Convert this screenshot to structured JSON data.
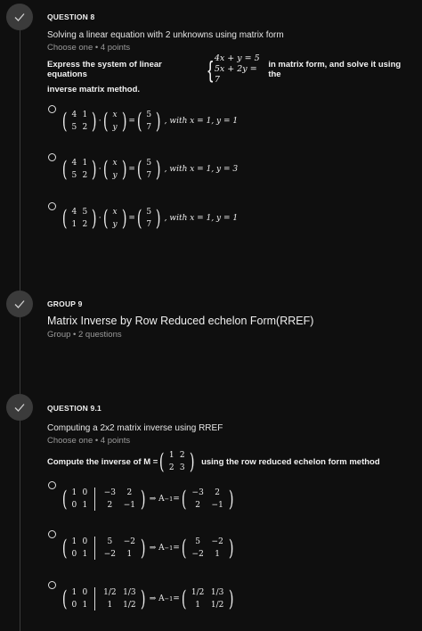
{
  "q8": {
    "label": "QUESTION 8",
    "title": "Solving a linear equation with 2 unknowns using matrix form",
    "meta": "Choose one • 4 points",
    "prompt_pre": "Express the system of linear equations",
    "eq1": "4x + y = 5",
    "eq2": "5x + 2y = 7",
    "prompt_post": "in matrix form, and solve it using the",
    "prompt_line2": "inverse matrix method.",
    "options": [
      {
        "m": [
          "4",
          "1",
          "5",
          "2"
        ],
        "v": [
          "x",
          "y"
        ],
        "r": [
          "5",
          "7"
        ],
        "tail": ", with x = 1, y = 1"
      },
      {
        "m": [
          "4",
          "1",
          "5",
          "2"
        ],
        "v": [
          "x",
          "y"
        ],
        "r": [
          "5",
          "7"
        ],
        "tail": ", with x = 1, y = 3"
      },
      {
        "m": [
          "4",
          "5",
          "1",
          "2"
        ],
        "v": [
          "x",
          "y"
        ],
        "r": [
          "5",
          "7"
        ],
        "tail": ", with x = 1, y = 1"
      }
    ]
  },
  "g9": {
    "label": "GROUP 9",
    "title": "Matrix Inverse by Row Reduced echelon Form(RREF)",
    "meta": "Group • 2 questions"
  },
  "q91": {
    "label": "QUESTION 9.1",
    "title": "Computing a 2x2 matrix inverse using RREF",
    "meta": "Choose one • 4 points",
    "prompt_pre": "Compute the inverse of M =",
    "M": [
      "1",
      "2",
      "2",
      "3"
    ],
    "prompt_post": "using the row reduced echelon form method",
    "options": [
      {
        "l": [
          "1",
          "0",
          "0",
          "1"
        ],
        "r": [
          "−3",
          "2",
          "2",
          "−1"
        ],
        "a": [
          "−3",
          "2",
          "2",
          "−1"
        ]
      },
      {
        "l": [
          "1",
          "0",
          "0",
          "1"
        ],
        "r": [
          "5",
          "−2",
          "−2",
          "1"
        ],
        "a": [
          "5",
          "−2",
          "−2",
          "1"
        ]
      },
      {
        "l": [
          "1",
          "0",
          "0",
          "1"
        ],
        "r": [
          "1/2",
          "1/3",
          "1",
          "1/2"
        ],
        "a": [
          "1/2",
          "1/3",
          "1",
          "1/2"
        ]
      }
    ]
  },
  "symbols": {
    "dot": "·",
    "eq": "=",
    "implies": "⇒ A",
    "inv": "−1",
    "icon": "check-icon"
  }
}
